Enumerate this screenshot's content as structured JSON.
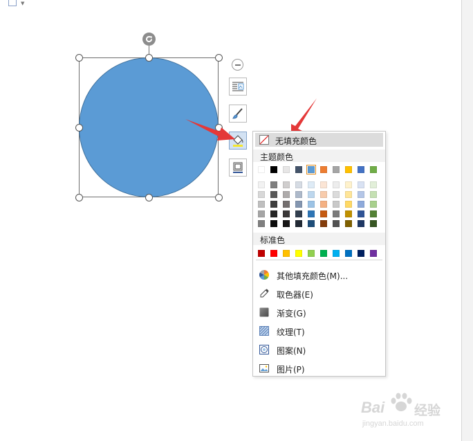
{
  "shape": {
    "fill": "#5b9bd5",
    "border": "#41719c"
  },
  "side_toolbar": {
    "buttons": [
      "layout-options",
      "shape-style",
      "shape-fill",
      "shape-outline"
    ],
    "active": "shape-fill"
  },
  "fill_menu": {
    "no_fill": "无填充颜色",
    "theme_colors_label": "主题颜色",
    "theme_top_row": [
      "#ffffff",
      "#000000",
      "#e7e6e6",
      "#44546a",
      "#5b9bd5",
      "#ed7d31",
      "#a5a5a5",
      "#ffc000",
      "#4472c4",
      "#70ad47"
    ],
    "theme_shades": [
      [
        "#f2f2f2",
        "#7f7f7f",
        "#d0cece",
        "#d6dce4",
        "#deebf6",
        "#fbe5d5",
        "#ededed",
        "#fff2cc",
        "#d9e2f3",
        "#e2efd9"
      ],
      [
        "#d8d8d8",
        "#595959",
        "#aeabab",
        "#adb9ca",
        "#bdd7ee",
        "#f7cbac",
        "#dbdbdb",
        "#ffe598",
        "#b4c6e7",
        "#c5e0b3"
      ],
      [
        "#bfbfbf",
        "#3f3f3f",
        "#757070",
        "#8496b0",
        "#9cc3e5",
        "#f4b183",
        "#c9c9c9",
        "#ffd965",
        "#8eaadb",
        "#a8d08d"
      ],
      [
        "#a5a5a5",
        "#262626",
        "#3a3838",
        "#323f4f",
        "#2e75b5",
        "#c55a11",
        "#7b7b7b",
        "#bf9000",
        "#2f5496",
        "#538135"
      ],
      [
        "#7f7f7f",
        "#0c0c0c",
        "#171616",
        "#222a35",
        "#1e4e79",
        "#833c0b",
        "#525252",
        "#7f6000",
        "#1f3864",
        "#375623"
      ]
    ],
    "selected_theme_index": 4,
    "standard_colors_label": "标准色",
    "standard_colors": [
      "#c00000",
      "#ff0000",
      "#ffc000",
      "#ffff00",
      "#92d050",
      "#00b050",
      "#00b0f0",
      "#0070c0",
      "#002060",
      "#7030a0"
    ],
    "items": [
      {
        "icon": "color-wheel-icon",
        "label": "其他填充颜色(M)..."
      },
      {
        "icon": "eyedropper-icon",
        "label": "取色器(E)"
      },
      {
        "icon": "gradient-icon",
        "label": "渐变(G)"
      },
      {
        "icon": "texture-icon",
        "label": "纹理(T)"
      },
      {
        "icon": "pattern-icon",
        "label": "图案(N)"
      },
      {
        "icon": "picture-icon",
        "label": "图片(P)"
      }
    ]
  },
  "watermark": {
    "brand": "Bai",
    "brand2": "经验",
    "url": "jingyan.baidu.com"
  }
}
